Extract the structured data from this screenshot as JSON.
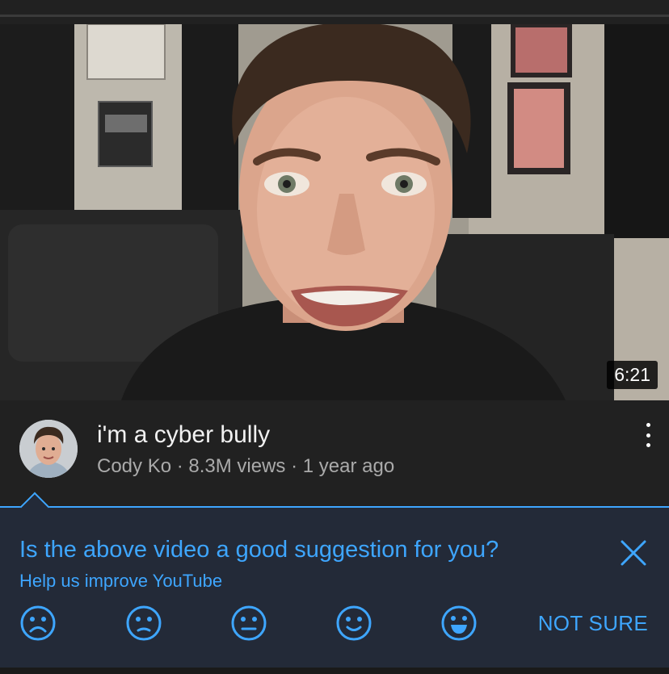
{
  "video": {
    "duration": "6:21",
    "title": "i'm a cyber bully",
    "channel": "Cody Ko",
    "views": "8.3M views",
    "age": "1 year ago",
    "separator": " · "
  },
  "survey": {
    "question": "Is the above video a good suggestion for you?",
    "helper": "Help us improve YouTube",
    "not_sure_label": "NOT SURE",
    "faces": [
      "very-sad-face-icon",
      "sad-face-icon",
      "neutral-face-icon",
      "slight-smile-face-icon",
      "big-smile-face-icon"
    ]
  },
  "colors": {
    "accent": "#3ea6ff",
    "background": "#212121",
    "survey_background": "#232a38"
  }
}
